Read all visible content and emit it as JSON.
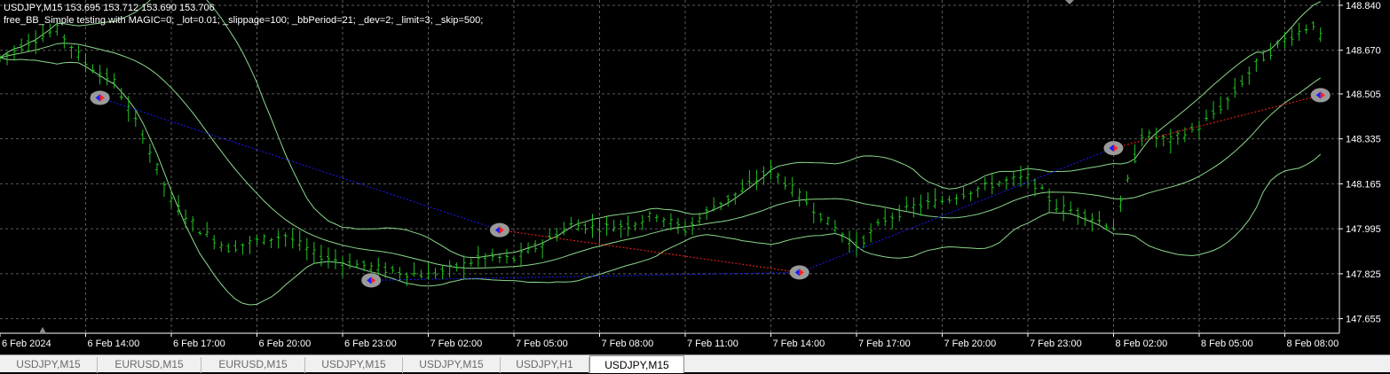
{
  "header": {
    "symbol_line": "USDJPY,M15  153.695 153.712 153.690 153.706",
    "ea_line": "free_BB_Simple testing with MAGIC=0; _lot=0.01; _slippage=100; _bbPeriod=21; _dev=2; _limit=3; _skip=500;"
  },
  "price_axis": [
    "148.840",
    "148.670",
    "148.505",
    "148.335",
    "148.165",
    "147.995",
    "147.825",
    "147.655"
  ],
  "time_axis": [
    "6 Feb 2024",
    "6 Feb 14:00",
    "6 Feb 17:00",
    "6 Feb 20:00",
    "6 Feb 23:00",
    "7 Feb 02:00",
    "7 Feb 05:00",
    "7 Feb 08:00",
    "7 Feb 11:00",
    "7 Feb 14:00",
    "7 Feb 17:00",
    "7 Feb 20:00",
    "7 Feb 23:00",
    "8 Feb 02:00",
    "8 Feb 05:00",
    "8 Feb 08:00"
  ],
  "tabs": [
    {
      "label": "USDJPY,M15",
      "active": false
    },
    {
      "label": "EURUSD,M15",
      "active": false
    },
    {
      "label": "EURUSD,M15",
      "active": false
    },
    {
      "label": "USDJPY,M15",
      "active": false
    },
    {
      "label": "USDJPY,M15",
      "active": false
    },
    {
      "label": "USDJPY,H1",
      "active": false
    },
    {
      "label": "USDJPY,M15",
      "active": true
    }
  ],
  "colors": {
    "background": "#000000",
    "grid": "#5a5a5a",
    "bar": "#22c322",
    "band": "#8bd88b",
    "buy_line": "#1a1aff",
    "sell_line": "#ff2020",
    "axis_text": "#ffffff"
  },
  "chart_data": {
    "type": "ohlc",
    "symbol": "USDJPY",
    "timeframe": "M15",
    "price_range": [
      147.6,
      148.86
    ],
    "time_range": [
      "6 Feb 11:00",
      "8 Feb 09:15"
    ],
    "close_path": [
      [
        "6 Feb 11:00",
        148.64
      ],
      [
        "6 Feb 12:00",
        148.7
      ],
      [
        "6 Feb 13:00",
        148.75
      ],
      [
        "6 Feb 14:00",
        148.62
      ],
      [
        "6 Feb 15:00",
        148.55
      ],
      [
        "6 Feb 16:00",
        148.35
      ],
      [
        "6 Feb 17:00",
        148.1
      ],
      [
        "6 Feb 18:00",
        147.99
      ],
      [
        "6 Feb 19:00",
        147.92
      ],
      [
        "6 Feb 20:00",
        147.95
      ],
      [
        "6 Feb 21:00",
        147.97
      ],
      [
        "6 Feb 22:00",
        147.9
      ],
      [
        "6 Feb 23:00",
        147.87
      ],
      [
        "7 Feb 00:00",
        147.85
      ],
      [
        "7 Feb 01:00",
        147.83
      ],
      [
        "7 Feb 02:00",
        147.82
      ],
      [
        "7 Feb 03:00",
        147.85
      ],
      [
        "7 Feb 04:00",
        147.89
      ],
      [
        "7 Feb 05:00",
        147.88
      ],
      [
        "7 Feb 06:00",
        147.94
      ],
      [
        "7 Feb 07:00",
        148.01
      ],
      [
        "7 Feb 08:00",
        148.0
      ],
      [
        "7 Feb 09:00",
        148.01
      ],
      [
        "7 Feb 10:00",
        148.05
      ],
      [
        "7 Feb 11:00",
        147.99
      ],
      [
        "7 Feb 12:00",
        148.08
      ],
      [
        "7 Feb 13:00",
        148.14
      ],
      [
        "7 Feb 14:00",
        148.22
      ],
      [
        "7 Feb 15:00",
        148.12
      ],
      [
        "7 Feb 16:00",
        148.02
      ],
      [
        "7 Feb 17:00",
        147.93
      ],
      [
        "7 Feb 18:00",
        148.03
      ],
      [
        "7 Feb 19:00",
        148.08
      ],
      [
        "7 Feb 20:00",
        148.1
      ],
      [
        "7 Feb 21:00",
        148.14
      ],
      [
        "7 Feb 22:00",
        148.17
      ],
      [
        "7 Feb 23:00",
        148.19
      ],
      [
        "8 Feb 00:00",
        148.08
      ],
      [
        "8 Feb 01:00",
        148.05
      ],
      [
        "8 Feb 02:00",
        148.0
      ],
      [
        "8 Feb 03:00",
        148.35
      ],
      [
        "8 Feb 04:00",
        148.33
      ],
      [
        "8 Feb 05:00",
        148.38
      ],
      [
        "8 Feb 06:00",
        148.48
      ],
      [
        "8 Feb 07:00",
        148.62
      ],
      [
        "8 Feb 08:00",
        148.71
      ],
      [
        "8 Feb 09:00",
        148.77
      ],
      [
        "8 Feb 09:15",
        148.72
      ]
    ],
    "bollinger": {
      "period": 21,
      "deviation": 2
    },
    "trades": [
      {
        "side": "buy",
        "entry": [
          "6 Feb 14:30",
          148.49
        ],
        "exit": [
          "7 Feb 04:30",
          147.99
        ]
      },
      {
        "side": "buy",
        "entry": [
          "7 Feb 00:00",
          147.8
        ],
        "exit": [
          "7 Feb 15:00",
          147.83
        ]
      },
      {
        "side": "sell",
        "entry": [
          "7 Feb 04:30",
          147.99
        ],
        "exit": [
          "7 Feb 15:00",
          147.83
        ]
      },
      {
        "side": "buy",
        "entry": [
          "7 Feb 15:00",
          147.83
        ],
        "exit": [
          "8 Feb 02:00",
          148.3
        ]
      },
      {
        "side": "sell",
        "entry": [
          "8 Feb 02:00",
          148.3
        ],
        "exit": [
          "8 Feb 09:15",
          148.5
        ]
      }
    ]
  }
}
